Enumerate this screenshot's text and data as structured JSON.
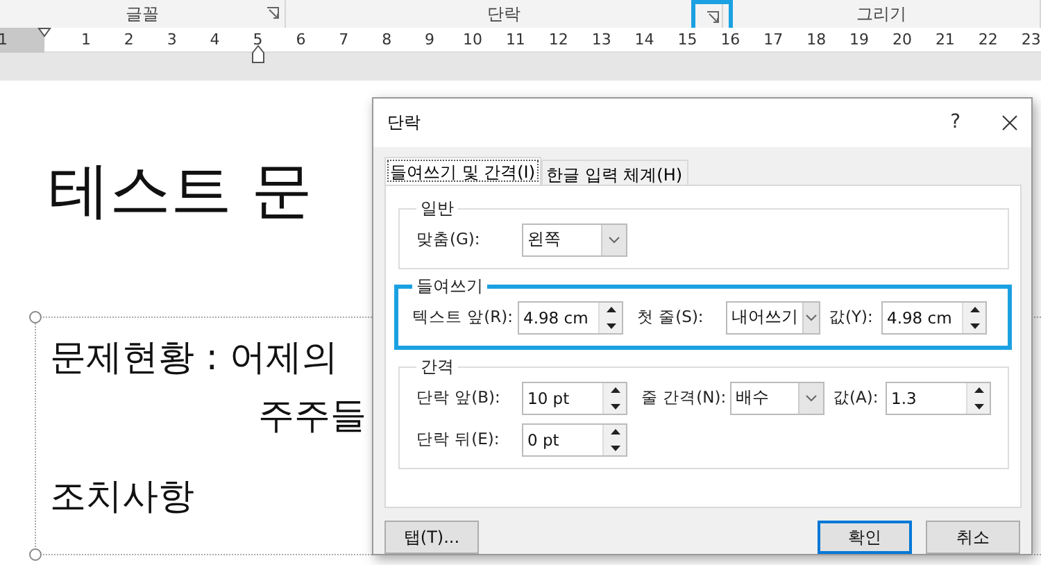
{
  "ribbon": {
    "groups": [
      {
        "label": "글꼴",
        "launcher": true,
        "highlighted": false
      },
      {
        "label": "단락",
        "launcher": true,
        "highlighted": true
      },
      {
        "label": "그리기",
        "launcher": false
      }
    ]
  },
  "ruler": {
    "labels": [
      "1",
      "1",
      "2",
      "3",
      "4",
      "5",
      "6",
      "7",
      "8",
      "9",
      "10",
      "11",
      "12",
      "13",
      "14",
      "15",
      "16",
      "17",
      "18",
      "19",
      "20",
      "21",
      "22",
      "23"
    ]
  },
  "document": {
    "title": "테스트 문",
    "lines": [
      {
        "text": "문제현황 : 어제의",
        "kind": "normal"
      },
      {
        "text": "주주들",
        "kind": "hanging"
      },
      {
        "text": "조치사항",
        "kind": "normal"
      }
    ]
  },
  "dialog": {
    "title": "단락",
    "help": "?",
    "tabs": [
      {
        "label": "들여쓰기 및 간격(I)",
        "selected": true
      },
      {
        "label": "한글 입력 체계(H)",
        "selected": false
      }
    ],
    "sections": [
      {
        "title": "일반",
        "highlighted": false,
        "rows": [
          [
            {
              "label": "맞춤(G):",
              "kind": "select",
              "value": "왼쪽"
            }
          ]
        ]
      },
      {
        "title": "들여쓰기",
        "highlighted": true,
        "rows": [
          [
            {
              "label": "텍스트 앞(R):",
              "kind": "spin",
              "value": "4.98 cm"
            },
            {
              "label": "첫 줄(S):",
              "kind": "select",
              "value": "내어쓰기"
            },
            {
              "label": "값(Y):",
              "kind": "spin",
              "value": "4.98 cm"
            }
          ]
        ]
      },
      {
        "title": "간격",
        "highlighted": false,
        "rows": [
          [
            {
              "label": "단락 앞(B):",
              "kind": "spin",
              "value": "10 pt"
            },
            {
              "label": "줄 간격(N):",
              "kind": "select",
              "value": "배수"
            },
            {
              "label": "값(A):",
              "kind": "spin",
              "value": "1.3"
            }
          ],
          [
            {
              "label": "단락 뒤(E):",
              "kind": "spin",
              "value": "0 pt"
            }
          ]
        ]
      }
    ],
    "buttons": [
      {
        "label": "탭(T)...",
        "default": false
      },
      {
        "label": "확인",
        "default": true
      },
      {
        "label": "취소",
        "default": false
      }
    ]
  }
}
